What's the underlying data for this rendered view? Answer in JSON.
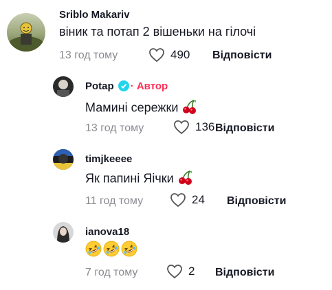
{
  "comments": [
    {
      "username": "Sriblo Makariv",
      "text": "віник та потап 2 вішеньки на гілочі",
      "time": "13 год тому",
      "likes": "490",
      "reply_label": "Відповісти"
    },
    {
      "username": "Potap",
      "author_badge": "· Автор",
      "text": "Мамині сережки",
      "emoji": "cherries-emoji",
      "time": "13 год тому",
      "likes": "136",
      "reply_label": "Відповісти"
    },
    {
      "username": "timjkeeee",
      "text": "Як папині Яічки",
      "emoji": "cherries-emoji",
      "time": "11 год тому",
      "likes": "24",
      "reply_label": "Відповісти"
    },
    {
      "username": "ianova18",
      "emoji": "rolling-laughing-emoji",
      "emoji_count": 3,
      "time": "7 год тому",
      "likes": "2",
      "reply_label": "Відповісти"
    }
  ],
  "colors": {
    "author": "#fe2c55",
    "verified": "#20d5ec",
    "muted": "#8a8b91",
    "text": "#161823"
  }
}
